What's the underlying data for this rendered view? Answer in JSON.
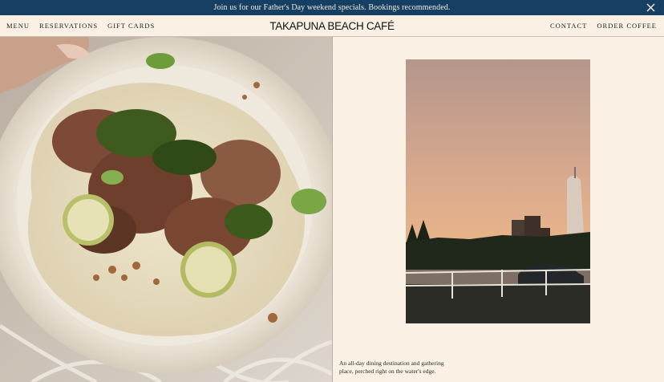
{
  "announcement": {
    "text": "Join us for our Father's Day weekend specials. Bookings recommended.",
    "close_icon": "close-icon"
  },
  "nav": {
    "left": [
      "MENU",
      "RESERVATIONS",
      "GIFT CARDS"
    ],
    "right": [
      "CONTACT",
      "ORDER COFFEE"
    ],
    "logo": "TAKAPUNA BEACH CAFÉ"
  },
  "hero": {
    "left_image": "food-dish-image",
    "right_image": "beach-sunset-skyline-image",
    "caption": "An all-day dining destination and gathering place, perched right on the water's edge."
  },
  "colors": {
    "announcement_bg": "#153f63",
    "page_bg": "#faf1e4",
    "text": "#1c1c1c"
  }
}
